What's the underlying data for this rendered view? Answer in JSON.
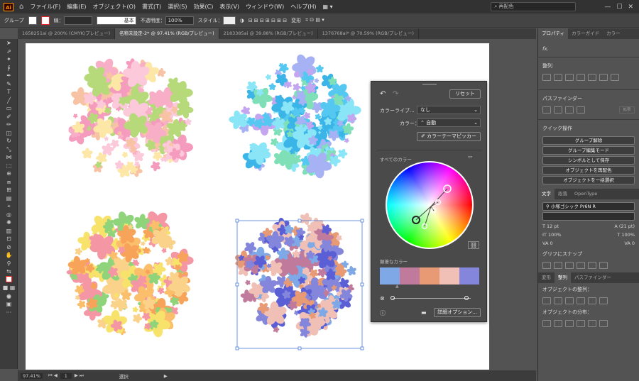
{
  "app": {
    "logo": "Ai",
    "home_icon": "home-icon"
  },
  "menu": [
    "ファイル(F)",
    "編集(E)",
    "オブジェクト(O)",
    "書式(T)",
    "選択(S)",
    "効果(C)",
    "表示(V)",
    "ウィンドウ(W)",
    "ヘルプ(H)"
  ],
  "search": {
    "value": "再配色"
  },
  "control": {
    "selection_type": "グループ",
    "stroke_label": "線：",
    "stroke_style": "基本",
    "opacity_label": "不透明度：",
    "opacity_value": "100%",
    "style_label": "スタイル：",
    "transform_label": "変形"
  },
  "tabs": [
    {
      "label": "1658251ai @ 200% (CMYK/プレビュー)",
      "active": false
    },
    {
      "label": "名称未設定-2* @ 97.41% (RGB/プレビュー)",
      "active": true
    },
    {
      "label": "2183385ai @ 39.88% (RGB/プレビュー)",
      "active": false
    },
    {
      "label": "1376768ai* @ 70.59% (RGB/プレビュー)",
      "active": false
    }
  ],
  "status": {
    "zoom": "97.41%",
    "artboard": "1",
    "mode": "選択"
  },
  "recolor": {
    "reset_label": "リセット",
    "library_label": "カラーライブ...",
    "library_value": "なし",
    "color_label": "カラー：",
    "color_value": "自動",
    "theme_picker_label": "カラーテーマピッカー",
    "all_colors_label": "すべてのカラー",
    "prominent_label": "顕著なカラー",
    "prominent_colors": [
      "#7ea8e6",
      "#c07a9c",
      "#e89a74",
      "#f0c0b6",
      "#8486dc"
    ],
    "advanced_label": "詳細オプション..."
  },
  "right_panel": {
    "tabs": [
      "プロパティ",
      "カラーガイド",
      "カラー"
    ],
    "fx_label": "fx.",
    "align_label": "整列",
    "pathfinder_label": "パスファインダー",
    "expand_label": "拡張",
    "quick_actions_label": "クイック操作",
    "quick_actions": [
      "グループ解除",
      "グループ編集モード",
      "シンボルとして保存",
      "オブジェクトを再配色",
      "オブジェクトを一括選択"
    ],
    "char_tabs": [
      "文字",
      "段落",
      "OpenType"
    ],
    "font_name": "小塚ゴシック Pr6N R",
    "font_size": "12 pt",
    "leading": "(21 pt)",
    "h_scale": "100%",
    "v_scale": "100%",
    "tracking": "0",
    "kerning": "0",
    "glyph_snap_label": "グリフにスナップ",
    "align_tabs": [
      "変形",
      "整列",
      "パスファインダー"
    ],
    "obj_align_label": "オブジェクトの整列：",
    "obj_dist_label": "オブジェクトの分布："
  },
  "artwork": {
    "groups": [
      {
        "name": "pink-flower-group",
        "colors": [
          "#f7aec6",
          "#fbc9d9",
          "#f59bbd",
          "#f8c2a4",
          "#b6d97a",
          "#fde7a6"
        ]
      },
      {
        "name": "cyan-flower-group",
        "colors": [
          "#54c8f0",
          "#8ae6f7",
          "#a7b2f5",
          "#7fe0b8",
          "#c4a6f0",
          "#3bb4e8"
        ]
      },
      {
        "name": "orange-flower-group",
        "colors": [
          "#f8a35a",
          "#fbbf6b",
          "#f7e36b",
          "#8fd47a",
          "#f596a4",
          "#fbd28a"
        ]
      },
      {
        "name": "blue-flower-group",
        "colors": [
          "#5b5fd6",
          "#8486dc",
          "#7ea8e6",
          "#c07a9c",
          "#e89a74",
          "#f0c0b6"
        ]
      }
    ]
  }
}
